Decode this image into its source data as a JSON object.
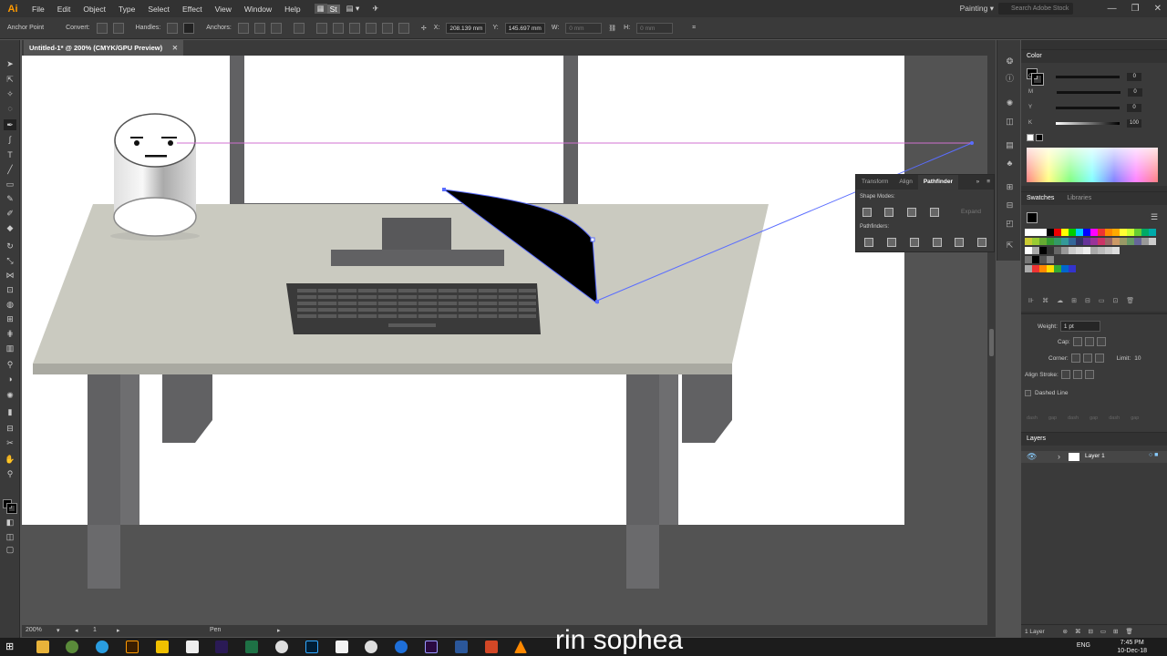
{
  "app": {
    "logo": "Ai",
    "workspace": "Painting",
    "search_placeholder": "Search Adobe Stock"
  },
  "menu": [
    "File",
    "Edit",
    "Object",
    "Type",
    "Select",
    "Effect",
    "View",
    "Window",
    "Help"
  ],
  "control_bar": {
    "anchor_point": "Anchor Point",
    "convert": "Convert:",
    "handles": "Handles:",
    "anchors": "Anchors:",
    "x_value": "208.139 mm",
    "y_value": "145.697 mm",
    "w_label": "W:",
    "w_value": "0 mm",
    "h_label": "H:",
    "h_value": "0 mm"
  },
  "document": {
    "tab_title": "Untitled-1* @ 200% (CMYK/GPU Preview)"
  },
  "status": {
    "zoom": "200%",
    "artboard": "1",
    "tool": "Pen"
  },
  "color_panel": {
    "title": "Color",
    "channels": [
      {
        "label": "C",
        "value": "0"
      },
      {
        "label": "M",
        "value": "0"
      },
      {
        "label": "Y",
        "value": "0"
      },
      {
        "label": "K",
        "value": "100"
      }
    ]
  },
  "swatches_panel": {
    "tabs": [
      "Swatches",
      "Libraries"
    ]
  },
  "stroke_panel": {
    "weight_label": "Weight:",
    "weight_value": "1 pt",
    "cap_label": "Cap:",
    "corner_label": "Corner:",
    "limit_label": "Limit:",
    "limit_value": "10",
    "align_label": "Align Stroke:",
    "dashed_label": "Dashed Line",
    "dash_labels": [
      "dash",
      "gap",
      "dash",
      "gap",
      "dash",
      "gap"
    ]
  },
  "layers_panel": {
    "title": "Layers",
    "layer_name": "Layer 1",
    "count": "1 Layer"
  },
  "pathfinder_panel": {
    "tabs": [
      "Transform",
      "Align",
      "Pathfinder"
    ],
    "shape_modes": "Shape Modes:",
    "expand": "Expand",
    "pathfinders": "Pathfinders:"
  },
  "taskbar": {
    "lang": "ENG",
    "time": "7:45 PM",
    "date": "10-Dec-18"
  },
  "watermark": "rin sophea",
  "colors": {
    "accent": "#ff9a00",
    "path_handle": "#5a6dff",
    "guide": "#d070d0"
  }
}
